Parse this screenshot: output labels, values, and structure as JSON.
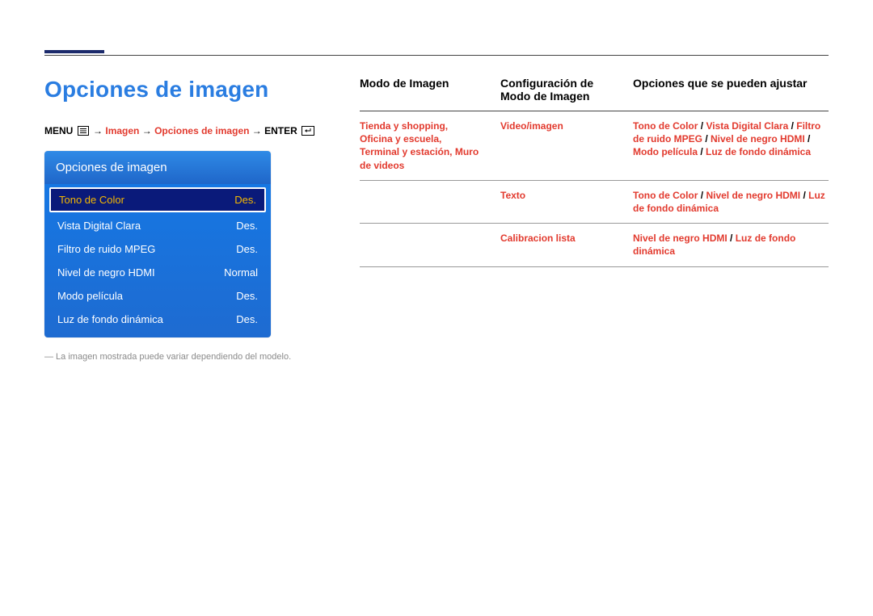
{
  "page_title": "Opciones de imagen",
  "breadcrumb": {
    "menu": "MENU",
    "arrow": "→",
    "imagen": "Imagen",
    "opciones": "Opciones de imagen",
    "enter": "ENTER"
  },
  "osd": {
    "title": "Opciones de imagen",
    "rows": [
      {
        "label": "Tono de Color",
        "value": "Des.",
        "selected": true
      },
      {
        "label": "Vista Digital Clara",
        "value": "Des.",
        "selected": false
      },
      {
        "label": "Filtro de ruido MPEG",
        "value": "Des.",
        "selected": false
      },
      {
        "label": "Nivel de negro HDMI",
        "value": "Normal",
        "selected": false
      },
      {
        "label": "Modo película",
        "value": "Des.",
        "selected": false
      },
      {
        "label": "Luz de fondo dinámica",
        "value": "Des.",
        "selected": false
      }
    ]
  },
  "footnote": "―  La imagen mostrada puede variar dependiendo del modelo.",
  "table": {
    "headers": {
      "c1": "Modo de Imagen",
      "c2": "Configuración de Modo de Imagen",
      "c3": "Opciones que se pueden ajustar"
    },
    "rows": [
      {
        "c1": "Tienda y shopping, Oficina y escuela, Terminal y estación, Muro de videos",
        "c2": "Video/imagen",
        "c3_pre": "Tono de Color ",
        "c3_slash1": "/ ",
        "c3_mid1": "Vista Digital Clara ",
        "c3_slash2": "/ ",
        "c3_mid2": "Filtro de ruido MPEG ",
        "c3_slash3": "/ ",
        "c3_mid3": "Nivel de negro HDMI ",
        "c3_slash4": "/ ",
        "c3_mid4": "Modo película ",
        "c3_slash5": "/ ",
        "c3_post": "Luz de fondo dinámica"
      },
      {
        "c1": "",
        "c2": "Texto",
        "c3_pre": "Tono de Color ",
        "c3_slash1": "/ ",
        "c3_mid1": "Nivel de negro HDMI ",
        "c3_slash2": "/ ",
        "c3_post": "Luz de fondo dinámica"
      },
      {
        "c1": "",
        "c2": "Calibracion lista",
        "c3_pre": "Nivel de negro HDMI ",
        "c3_slash1": "/ ",
        "c3_post": "Luz de fondo dinámica"
      }
    ]
  }
}
